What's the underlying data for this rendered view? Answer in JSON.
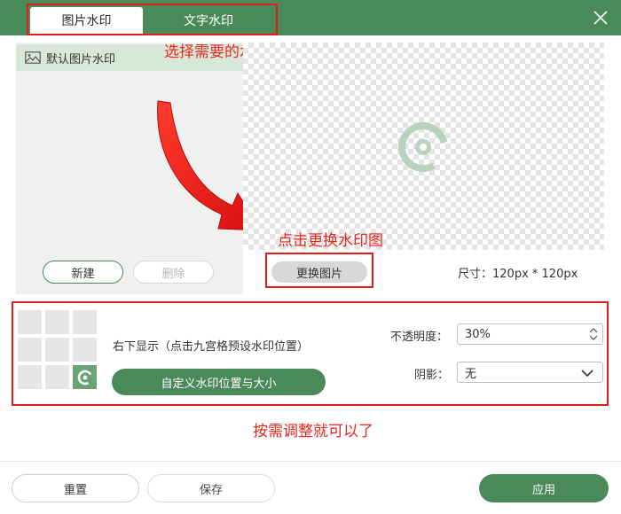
{
  "tabs": [
    {
      "label": "图片水印",
      "active": true
    },
    {
      "label": "文字水印",
      "active": false
    }
  ],
  "annotations": {
    "select_style": "选择需要的水印样式",
    "click_change": "点击更换水印图",
    "adjust": "按需调整就可以了"
  },
  "image_list": {
    "items": [
      "默认图片水印"
    ]
  },
  "left_buttons": {
    "new": "新建",
    "delete": "删除"
  },
  "preview": {
    "change_button": "更换图片",
    "size_text": "尺寸：120px * 120px"
  },
  "position": {
    "text": "右下显示（点击九宫格预设水印位置）",
    "custom_button": "自定义水印位置与大小",
    "selected_cell": 8
  },
  "opacity": {
    "label": "不透明度：",
    "value": "30%"
  },
  "shadow": {
    "label": "阴影：",
    "value": "无"
  },
  "footer": {
    "reset": "重置",
    "save": "保存",
    "apply": "应用"
  },
  "colors": {
    "primary": "#4a8a59",
    "annotation": "#e8261f"
  }
}
